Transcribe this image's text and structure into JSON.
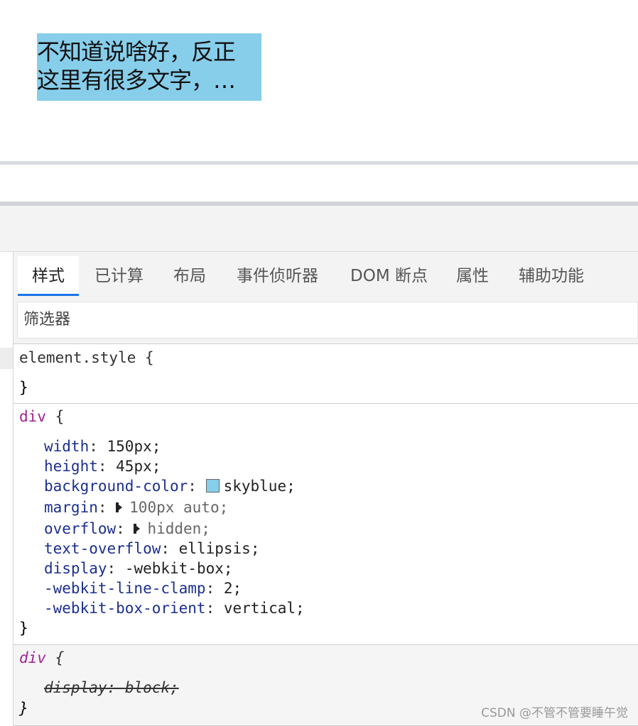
{
  "preview": {
    "line1": "不知道说啥好，反正",
    "line2": "这里有很多文字，…",
    "box_color": "#87ceeb"
  },
  "devtools": {
    "tabs": [
      {
        "label": "样式",
        "active": true
      },
      {
        "label": "已计算"
      },
      {
        "label": "布局"
      },
      {
        "label": "事件侦听器"
      },
      {
        "label": "DOM 断点"
      },
      {
        "label": "属性"
      },
      {
        "label": "辅助功能"
      }
    ],
    "filter_placeholder": "筛选器",
    "rules": {
      "element_style": {
        "selector": "element.style",
        "open": "{",
        "close": "}"
      },
      "div_rule": {
        "selector": "div",
        "open": "{",
        "close": "}",
        "props": [
          {
            "name": "width",
            "value": "150px;"
          },
          {
            "name": "height",
            "value": "45px;"
          },
          {
            "name": "background-color",
            "value": "skyblue;"
          },
          {
            "name": "margin",
            "value": "100px auto;"
          },
          {
            "name": "overflow",
            "value": "hidden;"
          },
          {
            "name": "text-overflow",
            "value": "ellipsis;"
          },
          {
            "name": "display",
            "value": "-webkit-box;"
          },
          {
            "name": "-webkit-line-clamp",
            "value": "2;"
          },
          {
            "name": "-webkit-box-orient",
            "value": "vertical;"
          }
        ]
      },
      "ua_rule": {
        "selector": "div",
        "open": "{",
        "close": "}",
        "props": [
          {
            "name": "display",
            "value": "block;"
          }
        ]
      }
    }
  },
  "watermark": "CSDN @不管不管要睡午觉"
}
